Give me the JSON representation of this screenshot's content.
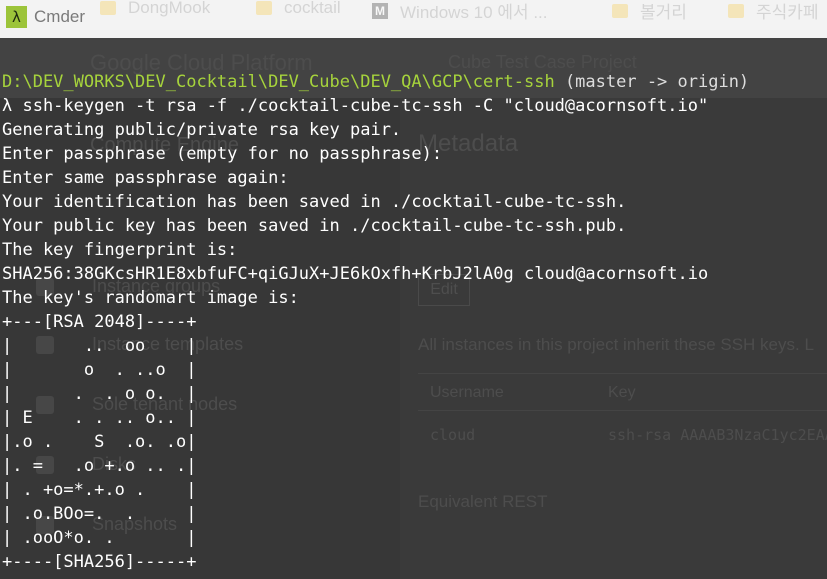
{
  "window": {
    "app_icon": "λ",
    "title": "Cmder",
    "background_tabs": [
      {
        "label": "DongMook",
        "icon": "folder-icon"
      },
      {
        "label": "cocktail",
        "icon": "folder-icon"
      },
      {
        "label": "Windows 10 에서 ...",
        "icon": "m-icon"
      },
      {
        "label": "볼거리",
        "icon": "folder-icon"
      },
      {
        "label": "주식카페",
        "icon": "folder-icon"
      }
    ]
  },
  "background_page": {
    "header_title": "Google Cloud Platform",
    "project": "Cube Test Case Project",
    "sidebar_title": "Compute Engine",
    "sidebar_items": [
      "Instance groups",
      "Instance templates",
      "Sole tenant nodes",
      "Disks",
      "Snapshots"
    ],
    "main_title": "Metadata",
    "edit_button": "Edit",
    "description": "All instances in this project inherit these SSH keys. L",
    "table_headers": [
      "Username",
      "Key"
    ],
    "table_row": {
      "username": "cloud",
      "key": "ssh-rsa AAAAB3NzaC1yc2EAA"
    },
    "rest_label": "Equivalent REST"
  },
  "terminal": {
    "prompt_path": "D:\\DEV_WORKS\\DEV_Cocktail\\DEV_Cube\\DEV_QA\\GCP\\cert-ssh",
    "prompt_branch": "(master -> origin)",
    "lines": [
      "λ ssh-keygen -t rsa -f ./cocktail-cube-tc-ssh -C \"cloud@acornsoft.io\"",
      "Generating public/private rsa key pair.",
      "Enter passphrase (empty for no passphrase):",
      "Enter same passphrase again:",
      "Your identification has been saved in ./cocktail-cube-tc-ssh.",
      "Your public key has been saved in ./cocktail-cube-tc-ssh.pub.",
      "The key fingerprint is:",
      "SHA256:38GKcsHR1E8xbfuFC+qiGJuX+JE6kOxfh+KrbJ2lA0g cloud@acornsoft.io",
      "The key's randomart image is:",
      "+---[RSA 2048]----+",
      "|       ..  oo    |",
      "|       o  . ..o  |",
      "|      .  . o o.  |",
      "| E    . . .. o.. |",
      "|.o .    S  .o. .o|",
      "|. =   .o +.o .. .|",
      "| . +o=*.+.o .    |",
      "| .o.BOo=.  .     |",
      "| .ooO*o. .       |",
      "+----[SHA256]-----+"
    ]
  },
  "colors": {
    "path": "#a6d33c",
    "text": "#ffffff",
    "background": "#2b2b2b"
  }
}
